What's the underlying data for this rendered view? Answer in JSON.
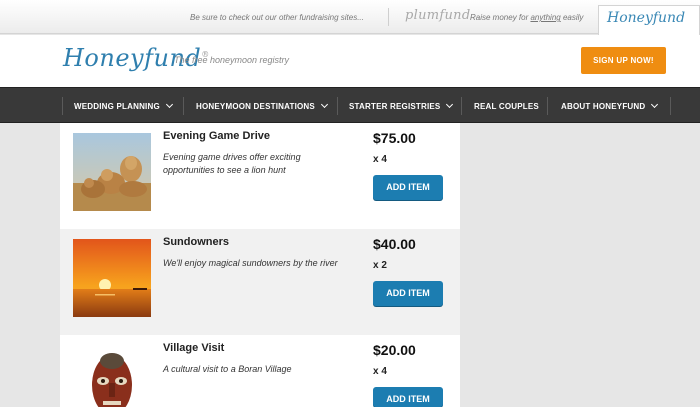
{
  "topbar": {
    "promo_text": "Be sure to check out our other fundraising sites...",
    "plumfund_logo": "plumfund",
    "raise_prefix": "Raise money for ",
    "raise_link": "anything",
    "raise_suffix": " easily",
    "honeyfund_tab": "Honeyfund"
  },
  "header": {
    "logo": "Honeyfund",
    "tagline": "The free honeymoon registry",
    "signup_label": "SIGN UP NOW!"
  },
  "nav": {
    "items": [
      {
        "label": "WEDDING PLANNING",
        "dropdown": true
      },
      {
        "label": "HONEYMOON DESTINATIONS",
        "dropdown": true
      },
      {
        "label": "STARTER REGISTRIES",
        "dropdown": true
      },
      {
        "label": "REAL COUPLES",
        "dropdown": false
      },
      {
        "label": "ABOUT HONEYFUND",
        "dropdown": true
      }
    ]
  },
  "items": [
    {
      "title": "Evening Game Drive",
      "description": "Evening game drives offer exciting opportunities to see a lion hunt",
      "price": "$75.00",
      "quantity": "x 4",
      "button": "ADD ITEM",
      "image": "lions-photo"
    },
    {
      "title": "Sundowners",
      "description": "We'll enjoy magical sundowners by the river",
      "price": "$40.00",
      "quantity": "x 2",
      "button": "ADD ITEM",
      "image": "sunset-photo"
    },
    {
      "title": "Village Visit",
      "description": "A cultural visit to a Boran Village",
      "price": "$20.00",
      "quantity": "x 4",
      "button": "ADD ITEM",
      "image": "tribal-mask-photo"
    }
  ],
  "colors": {
    "accent_orange": "#ef8d11",
    "brand_blue": "#2f7fae",
    "button_blue": "#1c7db1",
    "nav_bg": "#393939"
  }
}
